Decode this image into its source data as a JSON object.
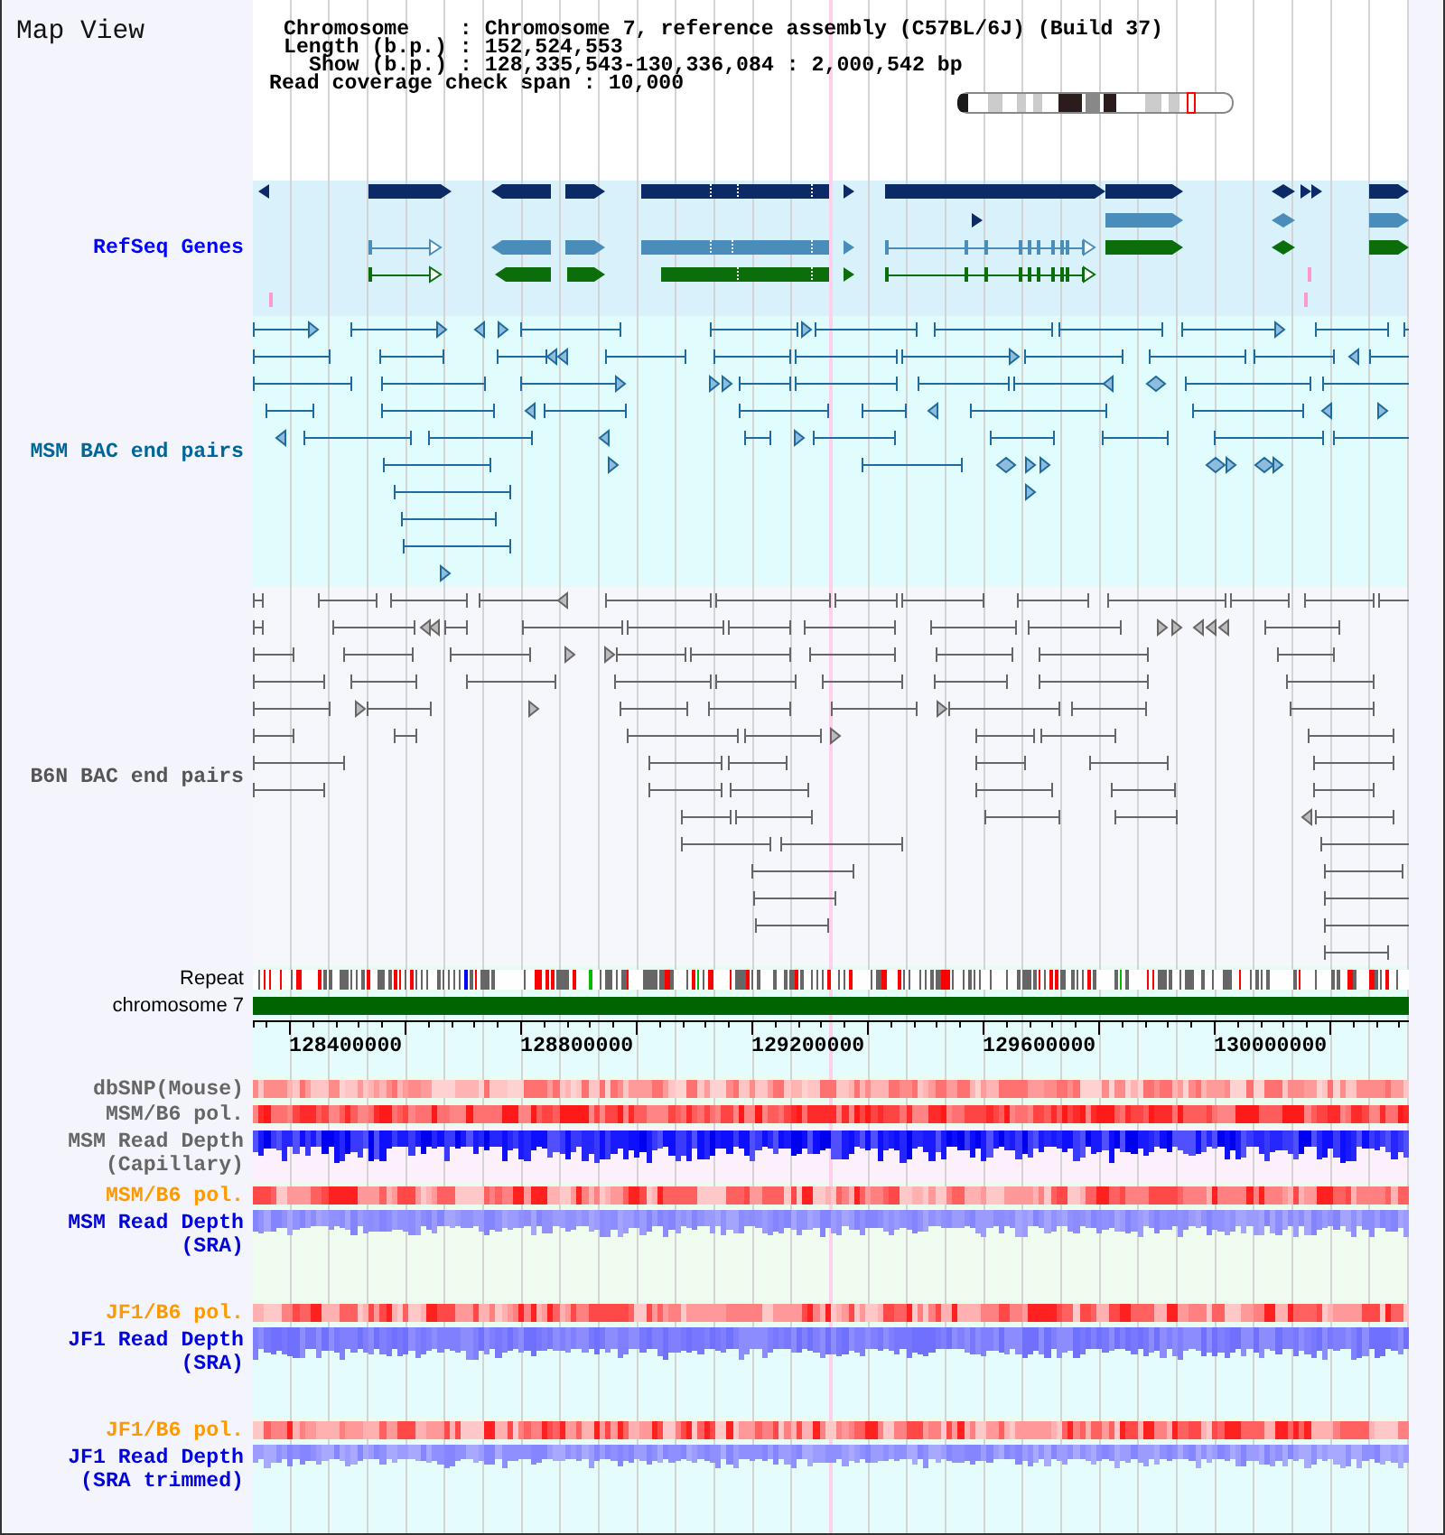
{
  "title": "Map View",
  "info_lines": [
    "Chromosome    : Chromosome 7, reference assembly (C57BL/6J) (Build 37)",
    "Length (b.p.) : 152,524,553",
    "Show (b.p.) : 128,335,543-130,336,084 : 2,000,542 bp",
    "Read coverage check span : 10,000"
  ],
  "tracks": [
    {
      "kind": "genes",
      "label": "RefSeq Genes",
      "color": "#0000ff"
    },
    {
      "kind": "bac_pairs",
      "label": "MSM BAC end pairs",
      "color": "#006699"
    },
    {
      "kind": "bac_pairs",
      "label": "B6N BAC end pairs",
      "color": "#555555"
    },
    {
      "kind": "repeat",
      "label": "Repeat",
      "color": "#000000"
    },
    {
      "kind": "chromosome",
      "label": "chromosome 7",
      "color": "#000000"
    },
    {
      "kind": "axis",
      "ticks": [
        "128400000",
        "128800000",
        "129200000",
        "129600000",
        "130000000"
      ]
    },
    {
      "kind": "heatmap",
      "label": "dbSNP(Mouse)",
      "color": "#666666"
    },
    {
      "kind": "heatmap",
      "label": "MSM/B6 pol.",
      "color": "#666666"
    },
    {
      "kind": "read_depth",
      "label": "MSM Read Depth (Capillary)",
      "color": "#666666"
    },
    {
      "kind": "heatmap",
      "label": "MSM/B6 pol.",
      "color": "#ff9900"
    },
    {
      "kind": "read_depth",
      "label": "MSM Read Depth (SRA)",
      "color": "#0000dd"
    },
    {
      "kind": "heatmap",
      "label": "JF1/B6 pol.",
      "color": "#ff9900"
    },
    {
      "kind": "read_depth",
      "label": "JF1 Read Depth (SRA)",
      "color": "#0000dd"
    },
    {
      "kind": "heatmap",
      "label": "JF1/B6 pol.",
      "color": "#ff9900"
    },
    {
      "kind": "read_depth",
      "label": "JF1 Read Depth (SRA trimmed)",
      "color": "#0000dd"
    }
  ]
}
